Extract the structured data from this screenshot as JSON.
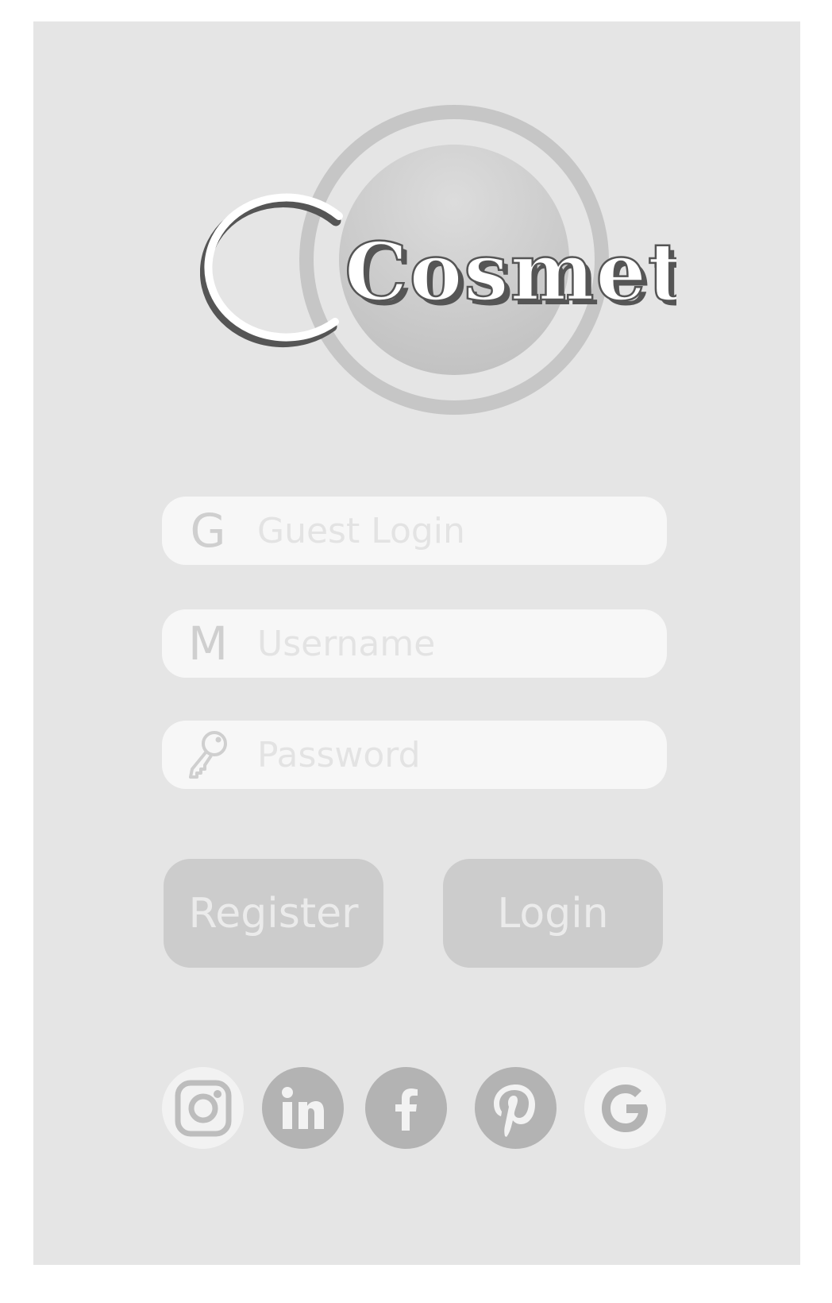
{
  "brand": {
    "logo_text": "Cosmet"
  },
  "form": {
    "guest": {
      "icon_letter": "G",
      "placeholder": "Guest Login"
    },
    "username": {
      "icon_letter": "M",
      "placeholder": "Username"
    },
    "password": {
      "icon": "key-icon",
      "placeholder": "Password"
    }
  },
  "buttons": {
    "register_label": "Register",
    "login_label": "Login"
  },
  "social": [
    {
      "name": "instagram",
      "icon": "instagram-icon"
    },
    {
      "name": "linkedin",
      "icon": "linkedin-icon"
    },
    {
      "name": "facebook",
      "icon": "facebook-icon"
    },
    {
      "name": "pinterest",
      "icon": "pinterest-icon"
    },
    {
      "name": "google",
      "icon": "google-icon"
    }
  ],
  "colors": {
    "background": "#e5e5e5",
    "field": "#f7f7f7",
    "button": "#cccccc",
    "social_dark": "#b3b3b3",
    "social_light": "#f2f2f2",
    "logo_fill": "#ffffff",
    "logo_shadow": "#555555"
  }
}
